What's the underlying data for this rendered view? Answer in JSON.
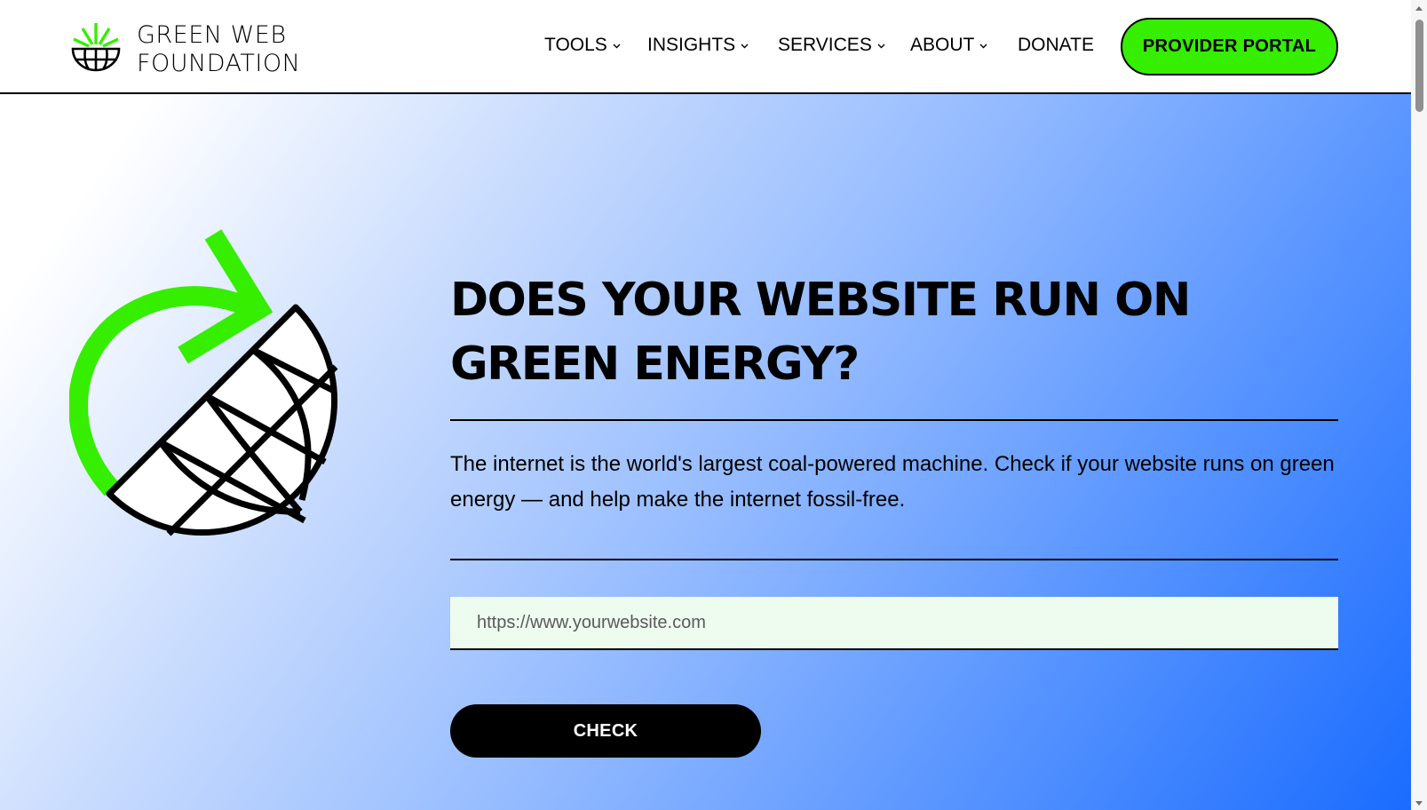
{
  "brand": {
    "line1": "GREEN WEB",
    "line2": "FOUNDATION",
    "accent_color": "#35ee00"
  },
  "nav": {
    "items": [
      {
        "label": "TOOLS",
        "has_dropdown": true
      },
      {
        "label": "INSIGHTS",
        "has_dropdown": true
      },
      {
        "label": "SERVICES",
        "has_dropdown": true
      },
      {
        "label": "ABOUT",
        "has_dropdown": true
      },
      {
        "label": "DONATE",
        "has_dropdown": false
      }
    ],
    "cta_label": "PROVIDER PORTAL"
  },
  "hero": {
    "heading_line1": "DOES YOUR WEBSITE RUN ON",
    "heading_line2": "GREEN ENERGY?",
    "lead": "The internet is the world's largest coal-powered machine. Check if your website runs on green energy — and help make the internet fossil-free.",
    "input_placeholder": "https://www.yourwebsite.com",
    "input_value": "",
    "check_label": "CHECK",
    "gradient_start": "#ffffff",
    "gradient_end": "#1a6cff"
  }
}
